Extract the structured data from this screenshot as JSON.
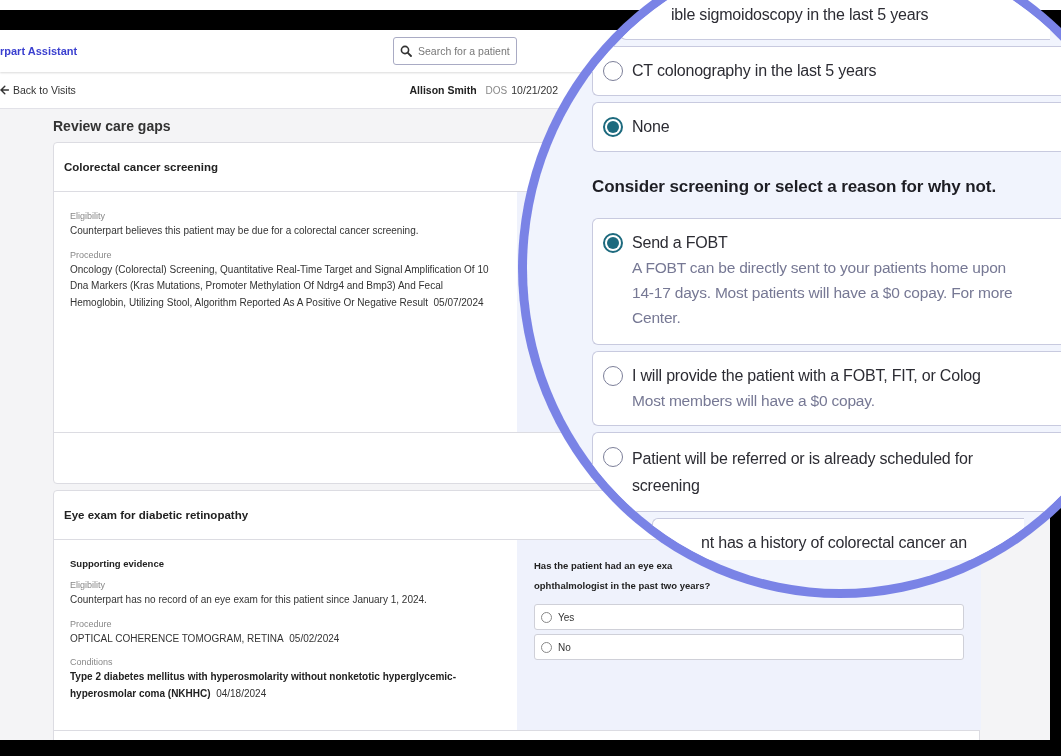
{
  "app_header": {
    "logo": "rpart Assistant",
    "search": {
      "placeholder": "Search for a patient"
    }
  },
  "visit_bar": {
    "back_link": "Back to Visits",
    "patient_name": "Allison Smith",
    "dos_label": "DOS",
    "dos_value": "10/21/202"
  },
  "page_title": "Review care gaps",
  "care_gaps": [
    {
      "title": "Colorectal cancer screening",
      "sections": [
        {
          "kind": "plain",
          "label": "Eligibility",
          "text": "Counterpart believes this patient may be due for a colorectal cancer screening."
        },
        {
          "kind": "plain",
          "label": "Procedure",
          "text": "Oncology (Colorectal) Screening, Quantitative Real-Time Target and Signal Amplification Of 10 Dna Markers (Kras Mutations, Promoter Methylation Of Ndrg4 and Bmp3) And Fecal Hemoglobin, Utilizing Stool, Algorithm Reported As A Positive Or Negative Result",
          "date": "05/07/2024"
        }
      ]
    },
    {
      "title": "Eye exam for diabetic retinopathy",
      "evidence_heading": "Supporting evidence",
      "sections": [
        {
          "kind": "plain",
          "label": "Eligibility",
          "text": "Counterpart has no record of an eye exam for this patient since January 1, 2024."
        },
        {
          "kind": "plain",
          "label": "Procedure",
          "text": "OPTICAL COHERENCE TOMOGRAM, RETINA",
          "date": "05/02/2024"
        },
        {
          "kind": "condition",
          "label": "Conditions",
          "text": "Type 2 diabetes mellitus with hyperosmolarity without nonketotic hyperglycemic-hyperosmolar coma (NKHHC)",
          "date": "04/18/2024"
        }
      ],
      "question": {
        "lines": [
          "Has the patient had an eye exa",
          "ophthalmologist in the past two years?"
        ],
        "options": [
          {
            "label": "Yes",
            "selected": false
          },
          {
            "label": "No",
            "selected": false
          }
        ]
      }
    }
  ],
  "magnifier": {
    "history_options": [
      {
        "kind": "partial",
        "lines": [
          "ible sigmoidoscopy in the last 5 years"
        ]
      },
      {
        "kind": "full",
        "lines": [
          "CT colonography in the last 5 years"
        ],
        "selected": false
      },
      {
        "kind": "full",
        "lines": [
          "None"
        ],
        "selected": true
      }
    ],
    "reason_heading": "Consider screening or select a reason for why not.",
    "reasons": [
      {
        "kind": "full",
        "lines": [
          "Send a FOBT"
        ],
        "description_lines": [
          "A FOBT can be directly sent to your patients home upon",
          "14-17 days. Most patients will have a $0 copay. For more",
          "Center."
        ],
        "selected": true
      },
      {
        "kind": "full",
        "lines": [
          "I will provide the patient with a FOBT, FIT, or Colog"
        ],
        "description_lines": [
          "Most members will have a $0 copay."
        ],
        "selected": false
      },
      {
        "kind": "full",
        "lines": [
          "Patient will be referred or is already scheduled for",
          "screening"
        ],
        "selected": false
      },
      {
        "kind": "partial",
        "lines": [
          "nt has a history of colorectal cancer an"
        ]
      }
    ]
  }
}
